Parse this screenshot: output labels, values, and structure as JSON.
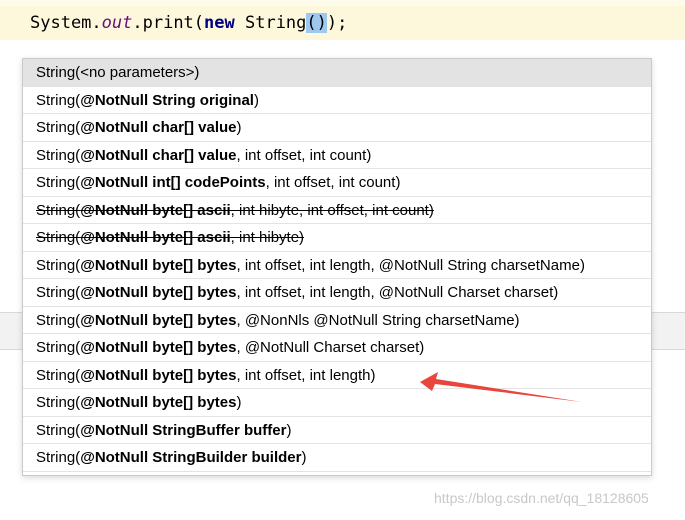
{
  "editor": {
    "line_prefix": "System.",
    "field": "out",
    "call": ".print(",
    "keyword": "new",
    "class_name": " String",
    "paren_open": "(",
    "paren_close": ")",
    "line_suffix": ");",
    "bottom_text": " "
  },
  "popup": {
    "items": [
      {
        "prefix": "String(",
        "ann": "",
        "rest": "<no parameters>)",
        "selected": true,
        "deprecated": false
      },
      {
        "prefix": "String(",
        "ann": "@NotNull String original",
        "rest": ")",
        "selected": false,
        "deprecated": false
      },
      {
        "prefix": "String(",
        "ann": "@NotNull char[] value",
        "rest": ")",
        "selected": false,
        "deprecated": false
      },
      {
        "prefix": "String(",
        "ann": "@NotNull char[] value",
        "rest": ", int offset, int count)",
        "selected": false,
        "deprecated": false
      },
      {
        "prefix": "String(",
        "ann": "@NotNull int[] codePoints",
        "rest": ", int offset, int count)",
        "selected": false,
        "deprecated": false
      },
      {
        "prefix": "String(",
        "ann": "@NotNull byte[] ascii",
        "rest": ", int hibyte, int offset, int count)",
        "selected": false,
        "deprecated": true
      },
      {
        "prefix": "String(",
        "ann": "@NotNull byte[] ascii",
        "rest": ", int hibyte)",
        "selected": false,
        "deprecated": true
      },
      {
        "prefix": "String(",
        "ann": "@NotNull byte[] bytes",
        "rest": ", int offset, int length, @NotNull String charsetName)",
        "selected": false,
        "deprecated": false
      },
      {
        "prefix": "String(",
        "ann": "@NotNull byte[] bytes",
        "rest": ", int offset, int length, @NotNull Charset charset)",
        "selected": false,
        "deprecated": false
      },
      {
        "prefix": "String(",
        "ann": "@NotNull byte[] bytes",
        "rest": ", @NonNls @NotNull String charsetName)",
        "selected": false,
        "deprecated": false
      },
      {
        "prefix": "String(",
        "ann": "@NotNull byte[] bytes",
        "rest": ", @NotNull Charset charset)",
        "selected": false,
        "deprecated": false
      },
      {
        "prefix": "String(",
        "ann": "@NotNull byte[] bytes",
        "rest": ", int offset, int length)",
        "selected": false,
        "deprecated": false
      },
      {
        "prefix": "String(",
        "ann": "@NotNull byte[] bytes",
        "rest": ")",
        "selected": false,
        "deprecated": false
      },
      {
        "prefix": "String(",
        "ann": "@NotNull StringBuffer buffer",
        "rest": ")",
        "selected": false,
        "deprecated": false
      },
      {
        "prefix": "String(",
        "ann": "@NotNull StringBuilder builder",
        "rest": ")",
        "selected": false,
        "deprecated": false
      }
    ]
  },
  "watermark": "https://blog.csdn.net/qq_18128605",
  "colors": {
    "arrow": "#e8453c",
    "paren_highlight": "#9ec8f0",
    "keyword": "#000080",
    "field": "#660e7a"
  }
}
